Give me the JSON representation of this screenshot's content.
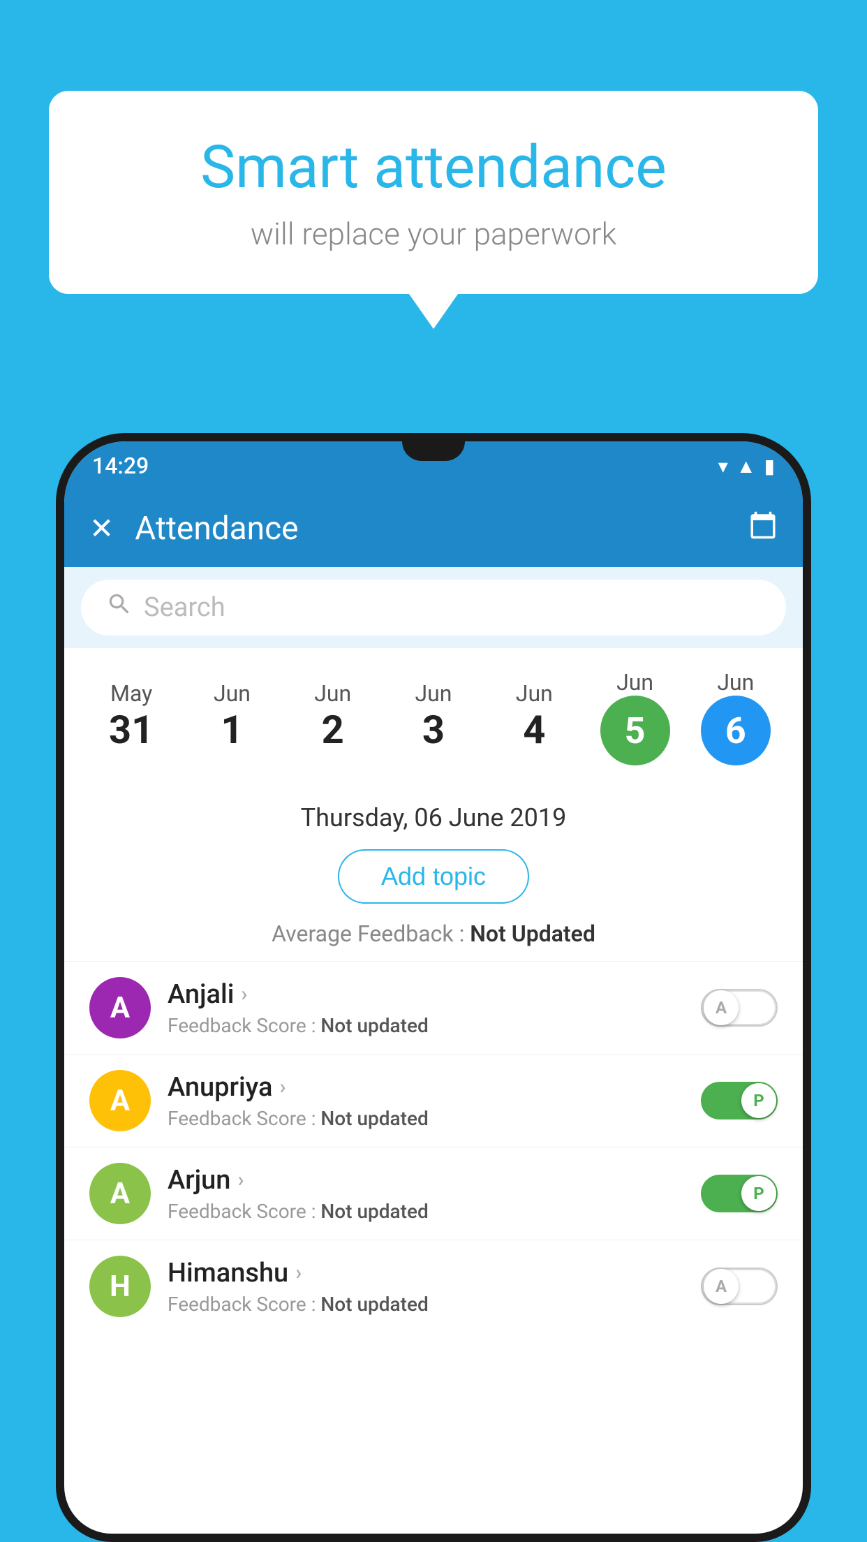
{
  "background_color": "#29b6e8",
  "speech_bubble": {
    "title": "Smart attendance",
    "subtitle": "will replace your paperwork"
  },
  "status_bar": {
    "time": "14:29",
    "wifi_icon": "▼",
    "signal_icon": "▲",
    "battery_icon": "▮"
  },
  "app_bar": {
    "close_label": "✕",
    "title": "Attendance",
    "calendar_icon": "📅"
  },
  "search": {
    "placeholder": "Search"
  },
  "calendar": {
    "dates": [
      {
        "month": "May",
        "day": "31",
        "type": "normal"
      },
      {
        "month": "Jun",
        "day": "1",
        "type": "normal"
      },
      {
        "month": "Jun",
        "day": "2",
        "type": "normal"
      },
      {
        "month": "Jun",
        "day": "3",
        "type": "normal"
      },
      {
        "month": "Jun",
        "day": "4",
        "type": "normal"
      },
      {
        "month": "Jun",
        "day": "5",
        "type": "green"
      },
      {
        "month": "Jun",
        "day": "6",
        "type": "blue"
      }
    ]
  },
  "selected_date": "Thursday, 06 June 2019",
  "add_topic_label": "Add topic",
  "avg_feedback_label": "Average Feedback : ",
  "avg_feedback_value": "Not Updated",
  "students": [
    {
      "name": "Anjali",
      "avatar_letter": "A",
      "avatar_color": "#9c27b0",
      "feedback_label": "Feedback Score : ",
      "feedback_value": "Not updated",
      "toggle_state": "off",
      "toggle_label": "A"
    },
    {
      "name": "Anupriya",
      "avatar_letter": "A",
      "avatar_color": "#ffc107",
      "feedback_label": "Feedback Score : ",
      "feedback_value": "Not updated",
      "toggle_state": "on",
      "toggle_label": "P"
    },
    {
      "name": "Arjun",
      "avatar_letter": "A",
      "avatar_color": "#8bc34a",
      "feedback_label": "Feedback Score : ",
      "feedback_value": "Not updated",
      "toggle_state": "on",
      "toggle_label": "P"
    },
    {
      "name": "Himanshu",
      "avatar_letter": "H",
      "avatar_color": "#8bc34a",
      "feedback_label": "Feedback Score : ",
      "feedback_value": "Not updated",
      "toggle_state": "off",
      "toggle_label": "A"
    }
  ]
}
